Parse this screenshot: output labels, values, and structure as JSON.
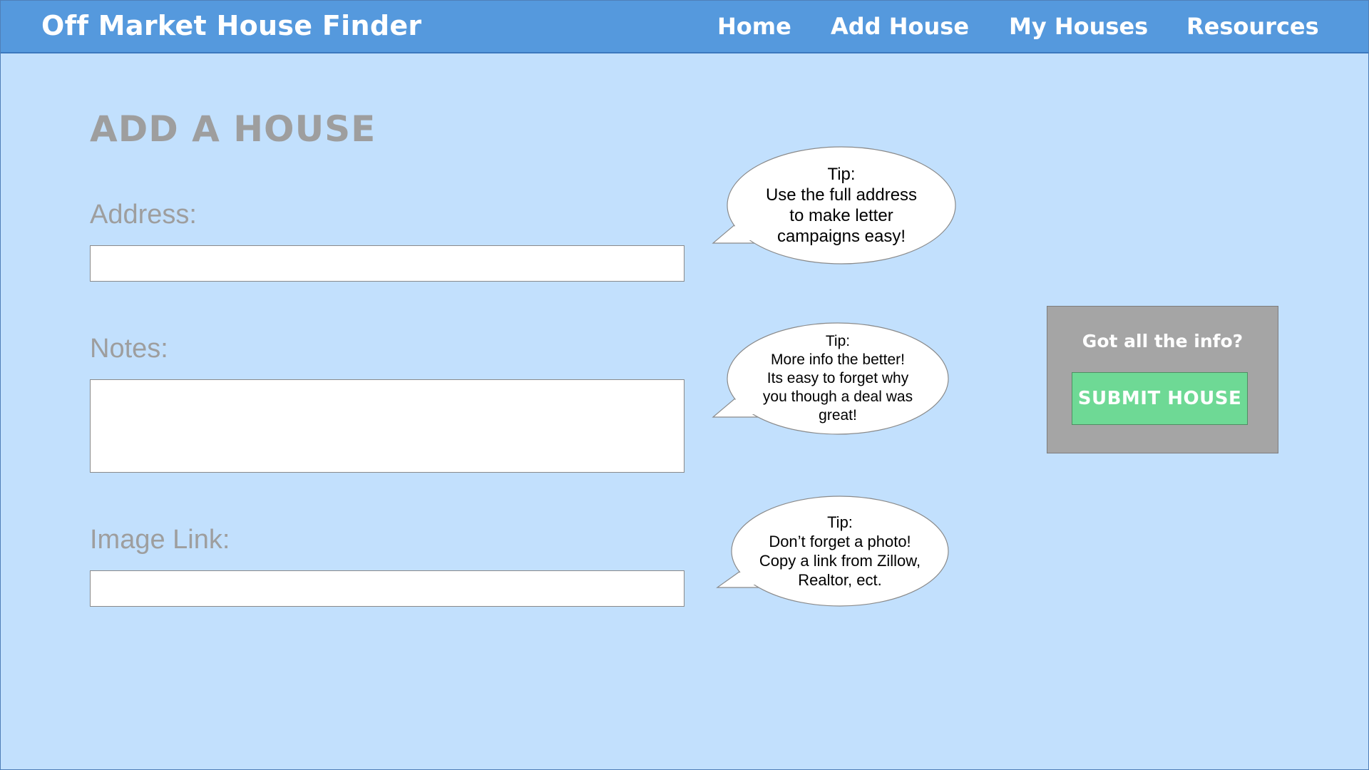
{
  "header": {
    "site_title": "Off Market House Finder",
    "nav": [
      "Home",
      "Add House",
      "My Houses",
      "Resources"
    ]
  },
  "page": {
    "heading": "ADD A HOUSE"
  },
  "form": {
    "address": {
      "label": "Address:",
      "value": "",
      "placeholder": ""
    },
    "notes": {
      "label": "Notes:",
      "value": "",
      "placeholder": ""
    },
    "image_link": {
      "label": "Image Link:",
      "value": "",
      "placeholder": ""
    }
  },
  "tips": {
    "address": [
      "Tip:",
      "Use the full address",
      "to make letter",
      "campaigns easy!"
    ],
    "notes": [
      "Tip:",
      "More info the better!",
      "Its easy to forget why",
      "you though a deal was",
      "great!"
    ],
    "image": [
      "Tip:",
      "Don’t forget a photo!",
      "Copy a link from Zillow,",
      "Realtor, ect."
    ]
  },
  "submit": {
    "prompt": "Got all the info?",
    "button_label": "SUBMIT HOUSE"
  },
  "colors": {
    "background": "#c2e0fd",
    "header": "#5599dd",
    "label_gray": "#9e9e9e",
    "panel_gray": "#a5a5a5",
    "button_green": "#6ed995"
  }
}
